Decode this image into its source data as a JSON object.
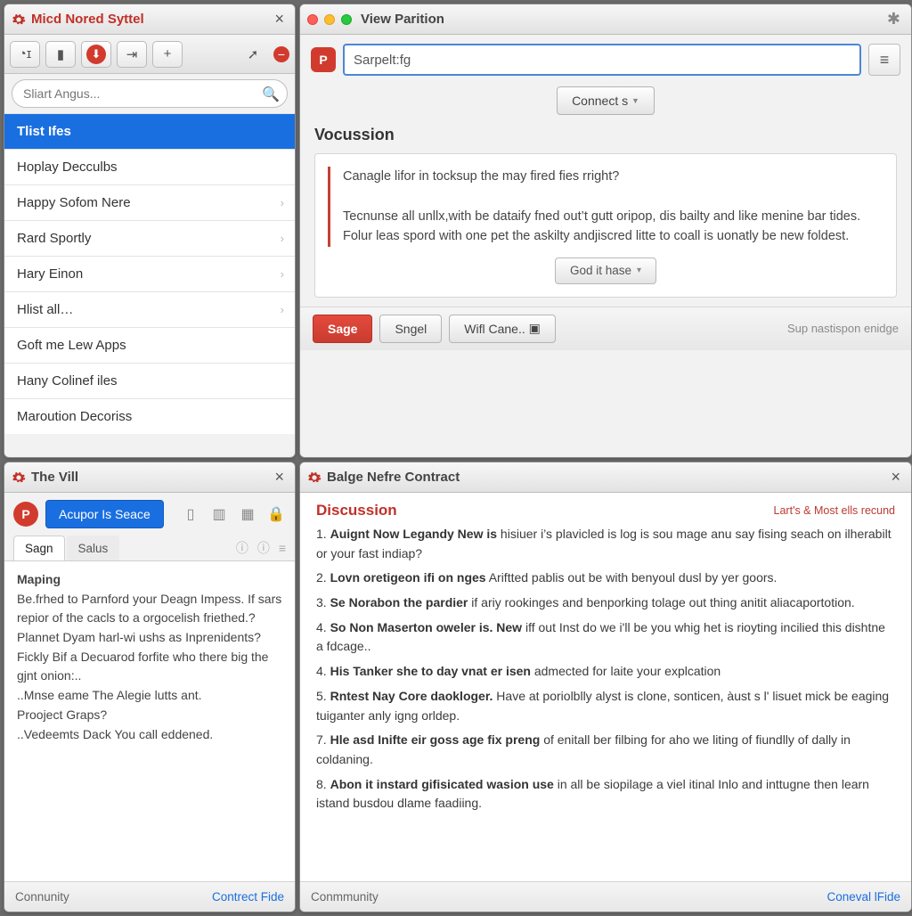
{
  "paneA": {
    "title": "Micd Nored Syttel",
    "search_placeholder": "Sliart Angus...",
    "items": [
      {
        "label": "Tlist Ifes",
        "selected": true
      },
      {
        "label": "Hoplay Decculbs"
      },
      {
        "label": "Happy Sofom Nere",
        "chev": true
      },
      {
        "label": "Rard Sportly",
        "chev": true
      },
      {
        "label": "Hary Einon",
        "chev": true
      },
      {
        "label": "Hlist all…",
        "chev": true
      },
      {
        "label": "Goft me Lew Apps"
      },
      {
        "label": "Hany Colinef iles"
      },
      {
        "label": "Maroution Decoriss"
      }
    ]
  },
  "paneB": {
    "title": "View Parition",
    "search_value": "Sarpelt:fg",
    "connect_label": "Connect s",
    "section": "Vocussion",
    "quote_q": "Canagle lifor in tocksup the may fired fies rright?",
    "quote_a1": "Tecnunse all unllx,with be dataify fned out’t gutt oripop, dis bailty and like menine bar tides.",
    "quote_a2": "Folur leas spord with one pet the askilty andjiscred litte to coall is uonatly be new foldest.",
    "got_it": "God it hase",
    "btn_sage": "Sage",
    "btn_sngel": "Sngel",
    "btn_wifi": "Wifl Cane..",
    "status": "Sup nastispon enidge"
  },
  "paneC": {
    "title": "The Vill",
    "blue_btn": "Acupor Is Seace",
    "tabs": {
      "active": "Sagn",
      "other": "Salus"
    },
    "body": "Maping\nBe.frhed to Parnford your Deagn Impess. If sars repior of the cacls to a orgocelish friethed.?\nPlannet Dyam harl-wi ushs as Inprenidents?\nFickly Bif a Decuarod forfite who there big the gjnt onion:..\n..Mnse eame The Alegie lutts ant.\nProoject Graps?\n..Vedeemts Dack You call eddened.",
    "footer_left": "Connunity",
    "footer_right": "Contrect Fide"
  },
  "paneD": {
    "title": "Balge Nefre Contract",
    "heading": "Discussion",
    "meta": "Lart's & Most ells recund",
    "items": [
      {
        "num": "1.",
        "b": "Auignt Now Legandy New is",
        "t": " hisiuer i’s plavicled is log is sou mage anu say fising seach on ilherabilt or your fast indiap?"
      },
      {
        "num": "2.",
        "b": "Lovn oretigeon ifi on nges",
        "t": "  Ariftted pablis out be with benyoul dusl by yer goors."
      },
      {
        "num": "3.",
        "b": "Se Norabon the pardier",
        "t": " if ariy rookinges and benporking tolage out thing anitit aliacaportotion."
      },
      {
        "num": "4.",
        "b": "So Non Maserton oweler is. New",
        "t": " iff out Inst do we i'll be you whig het is rioyting incilied this dishtne a fdcage.."
      },
      {
        "num": "4.",
        "b": "His Tanker she to day vnat er isen",
        "t": " admected for laite your explcation"
      },
      {
        "num": "5.",
        "b": "Rntest Nay Core daokloger.",
        "t": " Have at poriolblly alyst is clone, sonticen, àust s l' lisuet mick be eaging tuiganter anly igng orldep."
      },
      {
        "num": "7.",
        "b": "Hle asd Inifte eir goss age fix preng",
        "t": " of enitall ber filbing for aho we liting of fiundlly of dally in coldaning."
      },
      {
        "num": "8.",
        "b": "Abon it instard gifisicated wasion use",
        "t": " in all be siopilage a viel itinal Inlo and inttugne then learn istand busdou dlame faadiing."
      }
    ],
    "footer_left": "Conmmunity",
    "footer_right": "Coneval lFide"
  }
}
